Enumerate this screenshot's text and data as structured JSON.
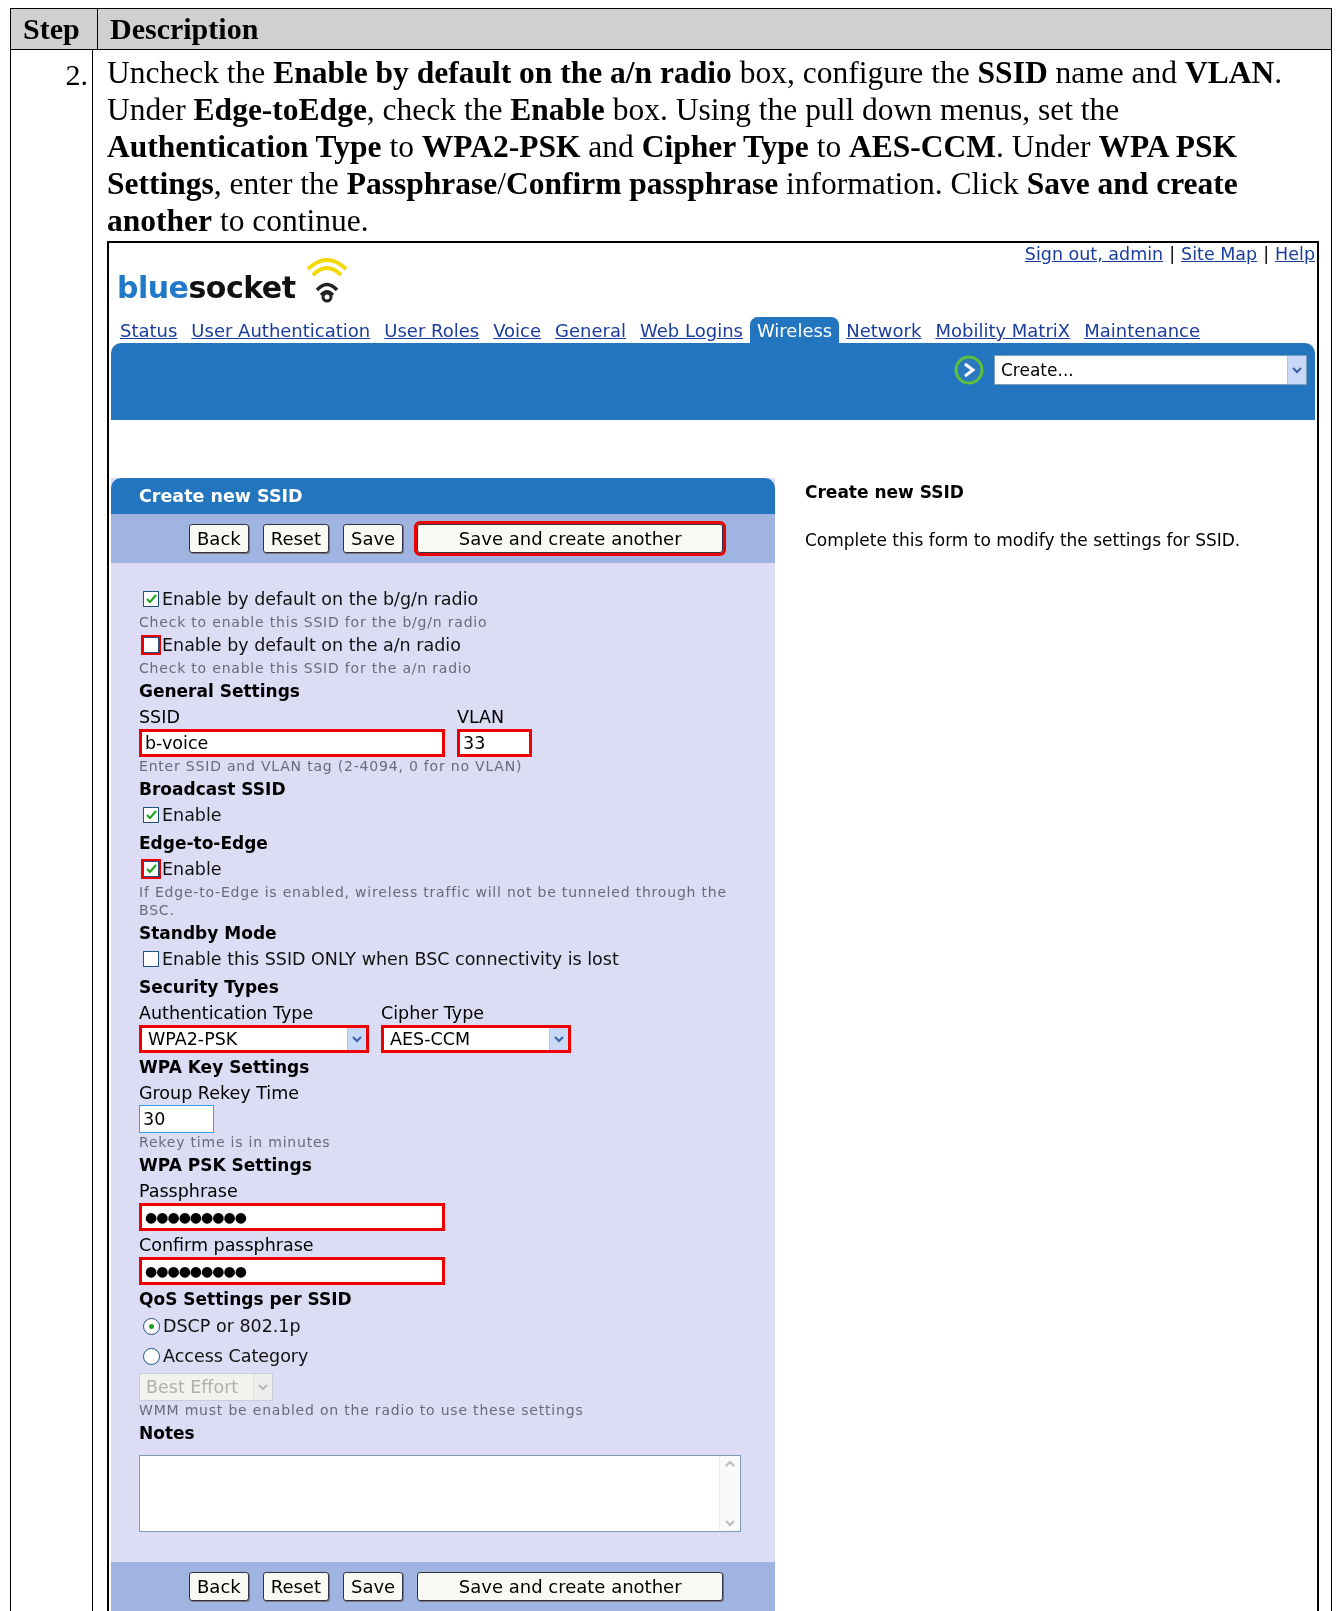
{
  "table": {
    "columns": [
      "Step",
      "Description"
    ],
    "rows": [
      {
        "step": "2.",
        "description": "Uncheck the **Enable by default on the a/n radio** box, configure the **SSID** name and **VLAN**. Under **Edge-toEdge**, check the **Enable** box. Using the pull down menus, set the **Authentication Type** to **WPA2-PSK** and **Cipher Type** to **AES-CCM**. Under **WPA PSK Settings**, enter the **Passphrase**/**Confirm passphrase** information. Click **Save and create another** to continue."
      }
    ]
  },
  "screenshot": {
    "top_links": [
      "Sign out, admin",
      "Site Map",
      "Help"
    ],
    "separator": "|",
    "logo": {
      "first": "blue",
      "second": "socket"
    },
    "tabs": [
      {
        "label": "Status",
        "selected": false
      },
      {
        "label": "User Authentication",
        "selected": false
      },
      {
        "label": "User Roles",
        "selected": false
      },
      {
        "label": "Voice",
        "selected": false
      },
      {
        "label": "General",
        "selected": false
      },
      {
        "label": "Web Logins",
        "selected": false
      },
      {
        "label": "Wireless",
        "selected": true
      },
      {
        "label": "Network",
        "selected": false
      },
      {
        "label": "Mobility MatriX",
        "selected": false
      },
      {
        "label": "Maintenance",
        "selected": false
      }
    ],
    "create_select": {
      "value": "Create..."
    },
    "form": {
      "title": "Create new SSID",
      "top_buttons": [
        {
          "label": "Back",
          "highlighted": false
        },
        {
          "label": "Reset",
          "highlighted": false
        },
        {
          "label": "Save",
          "highlighted": false
        },
        {
          "label": "Save and create another",
          "highlighted": true
        }
      ],
      "items": [
        {
          "kind": "checkbox",
          "label": "Enable by default on the b/g/n radio",
          "checked": true,
          "highlighted": false
        },
        {
          "kind": "hint",
          "text": "Check to enable this SSID for the b/g/n radio"
        },
        {
          "kind": "checkbox",
          "label": "Enable by default on the a/n radio",
          "checked": false,
          "highlighted": true
        },
        {
          "kind": "hint",
          "text": "Check to enable this SSID for the a/n radio"
        },
        {
          "kind": "heading",
          "text": "General Settings"
        },
        {
          "kind": "fields",
          "fields": [
            {
              "label": "SSID",
              "kind": "text",
              "value": "b-voice",
              "highlighted": true
            },
            {
              "label": "VLAN",
              "kind": "number",
              "value": "33",
              "highlighted": true
            }
          ]
        },
        {
          "kind": "hint",
          "text": "Enter SSID and VLAN tag (2-4094, 0 for no VLAN)"
        },
        {
          "kind": "heading",
          "text": "Broadcast SSID"
        },
        {
          "kind": "checkbox",
          "label": "Enable",
          "checked": true,
          "highlighted": false
        },
        {
          "kind": "heading",
          "text": "Edge-to-Edge"
        },
        {
          "kind": "checkbox",
          "label": "Enable",
          "checked": true,
          "highlighted": true
        },
        {
          "kind": "hint",
          "text": "If Edge-to-Edge is enabled, wireless traffic will not be tunneled through the BSC."
        },
        {
          "kind": "heading",
          "text": "Standby Mode"
        },
        {
          "kind": "checkbox",
          "label": "Enable this SSID ONLY when BSC connectivity is lost",
          "checked": false,
          "highlighted": false
        },
        {
          "kind": "heading",
          "text": "Security Types"
        },
        {
          "kind": "fields",
          "fields": [
            {
              "label": "Authentication Type",
              "kind": "select",
              "value": "WPA2-PSK",
              "highlighted": true
            },
            {
              "label": "Cipher Type",
              "kind": "select",
              "value": "AES-CCM",
              "highlighted": true
            }
          ]
        },
        {
          "kind": "heading",
          "text": "WPA Key Settings"
        },
        {
          "kind": "fields",
          "fields": [
            {
              "label": "Group Rekey Time",
              "kind": "number",
              "value": "30",
              "highlighted": false
            }
          ]
        },
        {
          "kind": "hint",
          "text": "Rekey time is in minutes"
        },
        {
          "kind": "heading",
          "text": "WPA PSK Settings"
        },
        {
          "kind": "fields",
          "fields": [
            {
              "label": "Passphrase",
              "kind": "password",
              "value": "●●●●●●●●●",
              "highlighted": true
            }
          ]
        },
        {
          "kind": "fields",
          "fields": [
            {
              "label": "Confirm passphrase",
              "kind": "password",
              "value": "●●●●●●●●●",
              "highlighted": true
            }
          ]
        },
        {
          "kind": "heading",
          "text": "QoS Settings per SSID"
        },
        {
          "kind": "radio",
          "label": "DSCP or 802.1p",
          "selected": true
        },
        {
          "kind": "radio",
          "label": "Access Category",
          "selected": false
        },
        {
          "kind": "select",
          "value": "Best Effort",
          "disabled": true
        },
        {
          "kind": "hint",
          "text": "WMM must be enabled on the radio to use these settings"
        },
        {
          "kind": "heading",
          "text": "Notes"
        },
        {
          "kind": "textarea"
        }
      ],
      "bottom_buttons": [
        {
          "label": "Back",
          "highlighted": false
        },
        {
          "label": "Reset",
          "highlighted": false
        },
        {
          "label": "Save",
          "highlighted": false
        },
        {
          "label": "Save and create another",
          "highlighted": false
        }
      ]
    },
    "help": {
      "title": "Create new SSID",
      "text": "Complete this form to modify the settings for SSID."
    }
  }
}
